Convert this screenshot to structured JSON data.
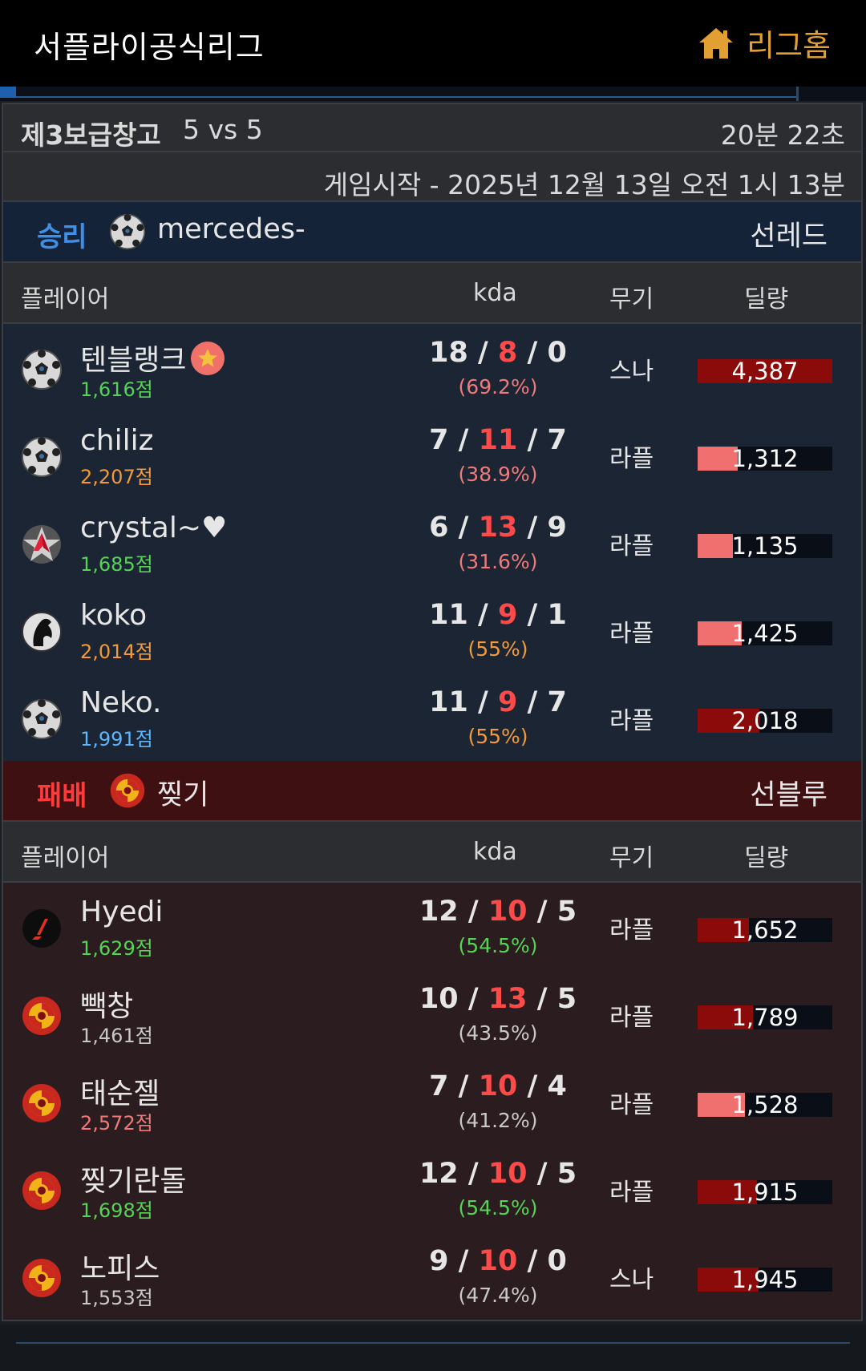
{
  "app": {
    "title": "서플라이공식리그",
    "home_label": "리그홈"
  },
  "game": {
    "map": "제3보급창고",
    "mode": "5 vs 5",
    "duration": "20분 22초",
    "start": "게임시작 - 2025년 12월 13일 오전 1시 13분"
  },
  "columns": {
    "player": "플레이어",
    "kda": "kda",
    "weapon": "무기",
    "damage": "딜량"
  },
  "colors": {
    "win_header": "#142338",
    "lose_header": "#3e1012",
    "damage_dark": "#8b0a0a",
    "damage_light": "#f07070",
    "death": "#ff4a4a"
  },
  "teams": [
    {
      "result": "승리",
      "clan": "mercedes-",
      "clan_icon": "soccer-ball-icon",
      "side": "선레드",
      "players": [
        {
          "name": "텐블랭크",
          "badge": "star-badge-icon",
          "score": "1,616점",
          "score_color": "green",
          "icon": "soccer-ball-icon",
          "k": "18",
          "d": "8",
          "a": "0",
          "pct": "(69.2%)",
          "pct_color": "pink",
          "weapon": "스나",
          "damage": "4,387",
          "damage_fill": 1.0,
          "fill_color": "dark"
        },
        {
          "name": "chiliz",
          "score": "2,207점",
          "score_color": "orange",
          "icon": "soccer-ball-icon",
          "k": "7",
          "d": "11",
          "a": "7",
          "pct": "(38.9%)",
          "pct_color": "pink",
          "weapon": "라플",
          "damage": "1,312",
          "damage_fill": 0.3,
          "fill_color": "light"
        },
        {
          "name": "crystal~♥",
          "score": "1,685점",
          "score_color": "green",
          "icon": "red-star-icon",
          "k": "6",
          "d": "13",
          "a": "9",
          "pct": "(31.6%)",
          "pct_color": "pink",
          "weapon": "라플",
          "damage": "1,135",
          "damage_fill": 0.26,
          "fill_color": "light"
        },
        {
          "name": "koko",
          "score": "2,014점",
          "score_color": "orange",
          "icon": "horse-head-icon",
          "k": "11",
          "d": "9",
          "a": "1",
          "pct": "(55%)",
          "pct_color": "orange",
          "weapon": "라플",
          "damage": "1,425",
          "damage_fill": 0.33,
          "fill_color": "light"
        },
        {
          "name": "Neko.",
          "score": "1,991점",
          "score_color": "blue",
          "icon": "soccer-ball-icon",
          "k": "11",
          "d": "9",
          "a": "7",
          "pct": "(55%)",
          "pct_color": "orange",
          "weapon": "라플",
          "damage": "2,018",
          "damage_fill": 0.46,
          "fill_color": "dark"
        }
      ]
    },
    {
      "result": "패배",
      "clan": "찢기",
      "clan_icon": "sun-swirl-icon",
      "side": "선블루",
      "players": [
        {
          "name": "Hyedi",
          "score": "1,629점",
          "score_color": "green",
          "icon": "black-emblem-icon",
          "k": "12",
          "d": "10",
          "a": "5",
          "pct": "(54.5%)",
          "pct_color": "green",
          "weapon": "라플",
          "damage": "1,652",
          "damage_fill": 0.38,
          "fill_color": "dark"
        },
        {
          "name": "빽창",
          "score": "1,461점",
          "score_color": "grey",
          "icon": "sun-swirl-icon",
          "k": "10",
          "d": "13",
          "a": "5",
          "pct": "(43.5%)",
          "pct_color": "grey",
          "weapon": "라플",
          "damage": "1,789",
          "damage_fill": 0.41,
          "fill_color": "dark"
        },
        {
          "name": "태순젤",
          "score": "2,572점",
          "score_color": "pink",
          "icon": "sun-swirl-icon",
          "k": "7",
          "d": "10",
          "a": "4",
          "pct": "(41.2%)",
          "pct_color": "grey",
          "weapon": "라플",
          "damage": "1,528",
          "damage_fill": 0.35,
          "fill_color": "light"
        },
        {
          "name": "찢기란돌",
          "score": "1,698점",
          "score_color": "green",
          "icon": "sun-swirl-icon",
          "k": "12",
          "d": "10",
          "a": "5",
          "pct": "(54.5%)",
          "pct_color": "green",
          "weapon": "라플",
          "damage": "1,915",
          "damage_fill": 0.44,
          "fill_color": "dark"
        },
        {
          "name": "노피스",
          "score": "1,553점",
          "score_color": "grey",
          "icon": "sun-swirl-icon",
          "k": "9",
          "d": "10",
          "a": "0",
          "pct": "(47.4%)",
          "pct_color": "grey",
          "weapon": "스나",
          "damage": "1,945",
          "damage_fill": 0.45,
          "fill_color": "dark"
        }
      ]
    }
  ]
}
